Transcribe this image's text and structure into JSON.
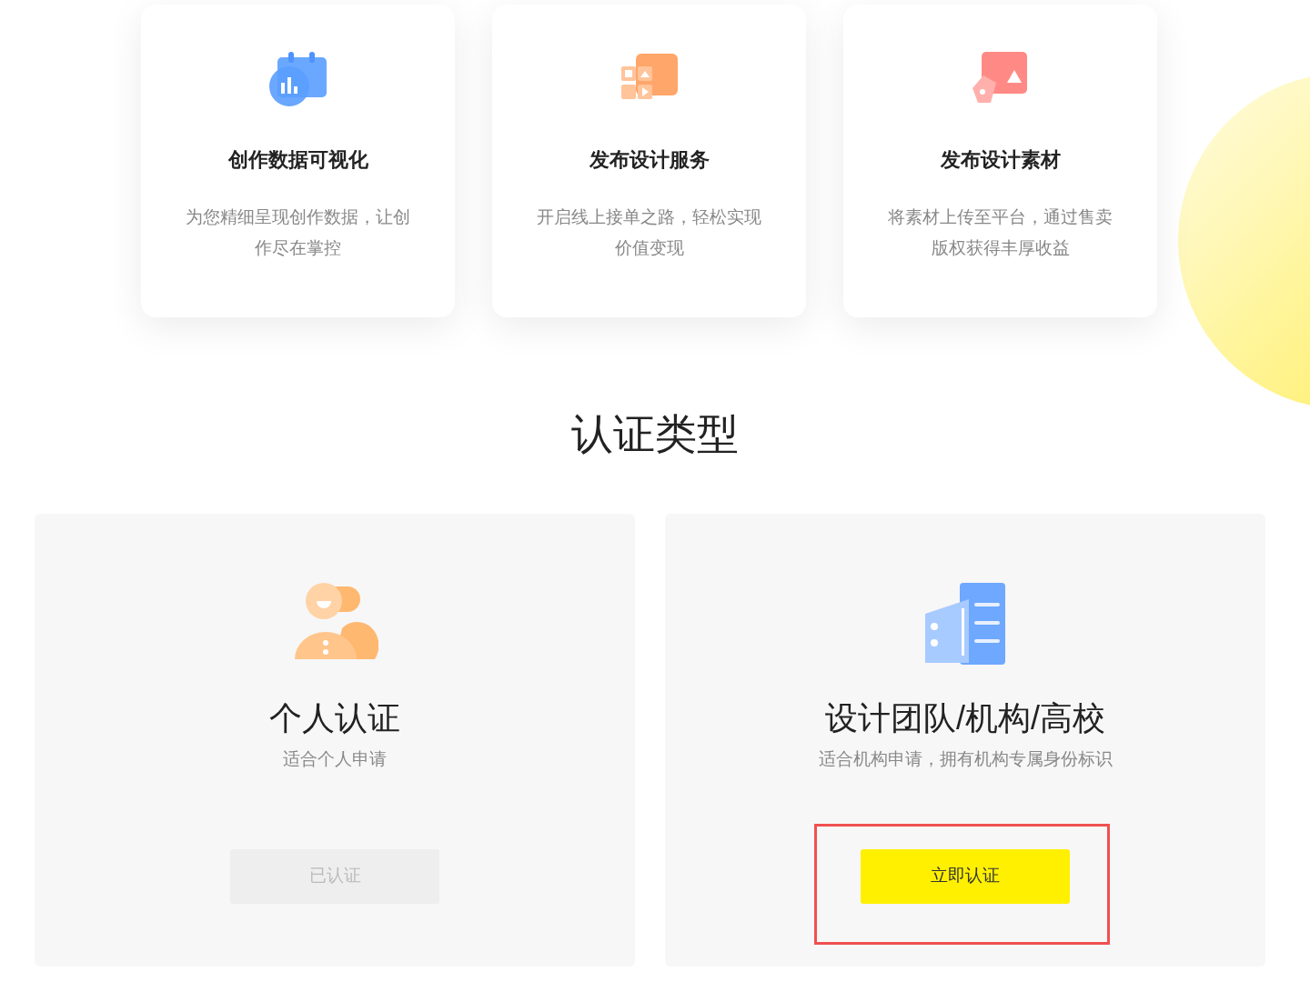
{
  "features": [
    {
      "kind": "chart",
      "title": "创作数据可视化",
      "description": "为您精细呈现创作数据，让创作尽在掌控"
    },
    {
      "kind": "shop",
      "title": "发布设计服务",
      "description": "开启线上接单之路，轻松实现价值变现"
    },
    {
      "kind": "material",
      "title": "发布设计素材",
      "description": "将素材上传至平台，通过售卖版权获得丰厚收益"
    }
  ],
  "section_title": "认证类型",
  "types": [
    {
      "kind": "person",
      "title": "个人认证",
      "subtitle": "适合个人申请",
      "button": "已认证",
      "disabled": true,
      "highlighted": false
    },
    {
      "kind": "organization",
      "title": "设计团队/机构/高校",
      "subtitle": "适合机构申请，拥有机构专属身份标识",
      "button": "立即认证",
      "disabled": false,
      "highlighted": true
    }
  ]
}
